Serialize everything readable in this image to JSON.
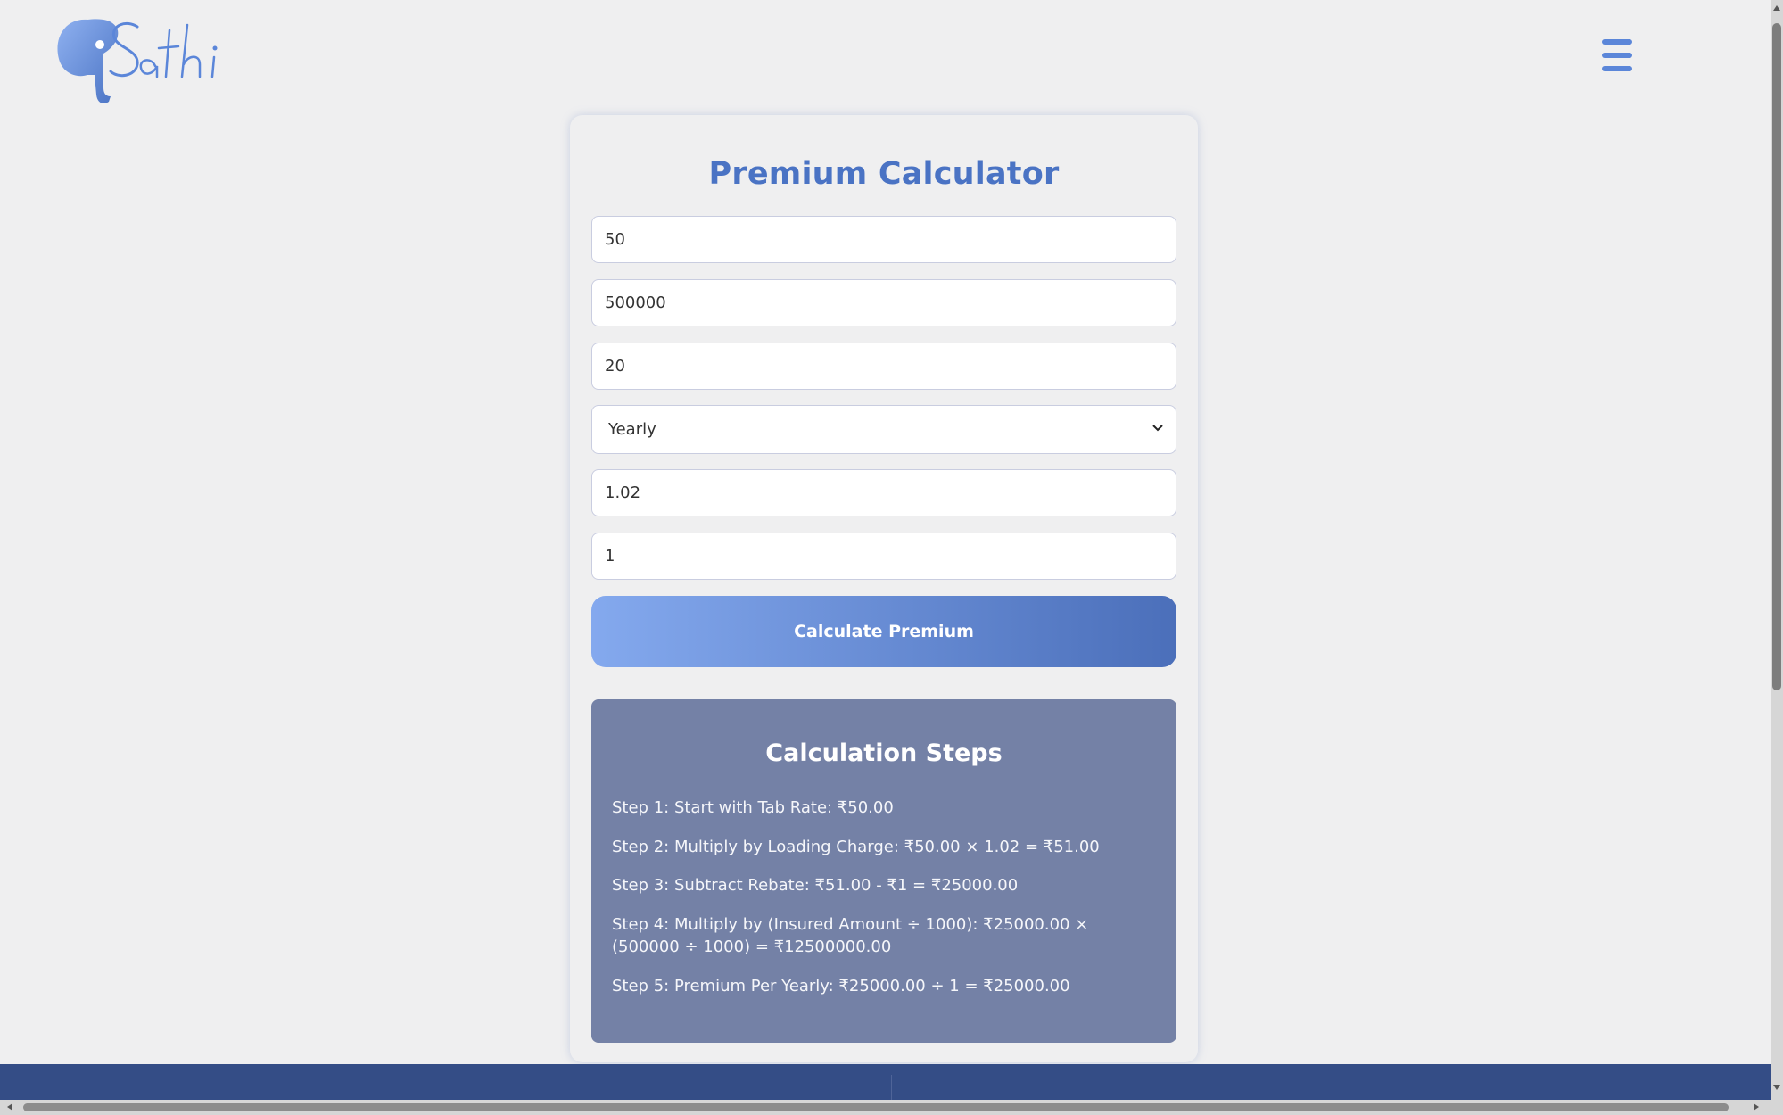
{
  "header": {
    "logo_text": "Sathi",
    "menu_icon": "hamburger-menu-icon"
  },
  "calculator": {
    "title": "Premium Calculator",
    "fields": {
      "tab_rate": "50",
      "insured_amount": "500000",
      "term": "20",
      "frequency": "Yearly",
      "loading_charge": "1.02",
      "rebate": "1"
    },
    "button_label": "Calculate Premium"
  },
  "steps": {
    "title": "Calculation Steps",
    "items": [
      "Step 1: Start with Tab Rate: ₹50.00",
      "Step 2: Multiply by Loading Charge: ₹50.00 × 1.02 = ₹51.00",
      "Step 3: Subtract Rebate: ₹51.00 - ₹1 = ₹25000.00",
      "Step 4: Multiply by (Insured Amount ÷ 1000): ₹25000.00 × (500000 ÷ 1000) = ₹12500000.00",
      "Step 5: Premium Per Yearly: ₹25000.00 ÷ 1 = ₹25000.00"
    ]
  },
  "colors": {
    "accent": "#4a73c4",
    "steps_bg": "#7481a6",
    "footer": "#344d86"
  }
}
